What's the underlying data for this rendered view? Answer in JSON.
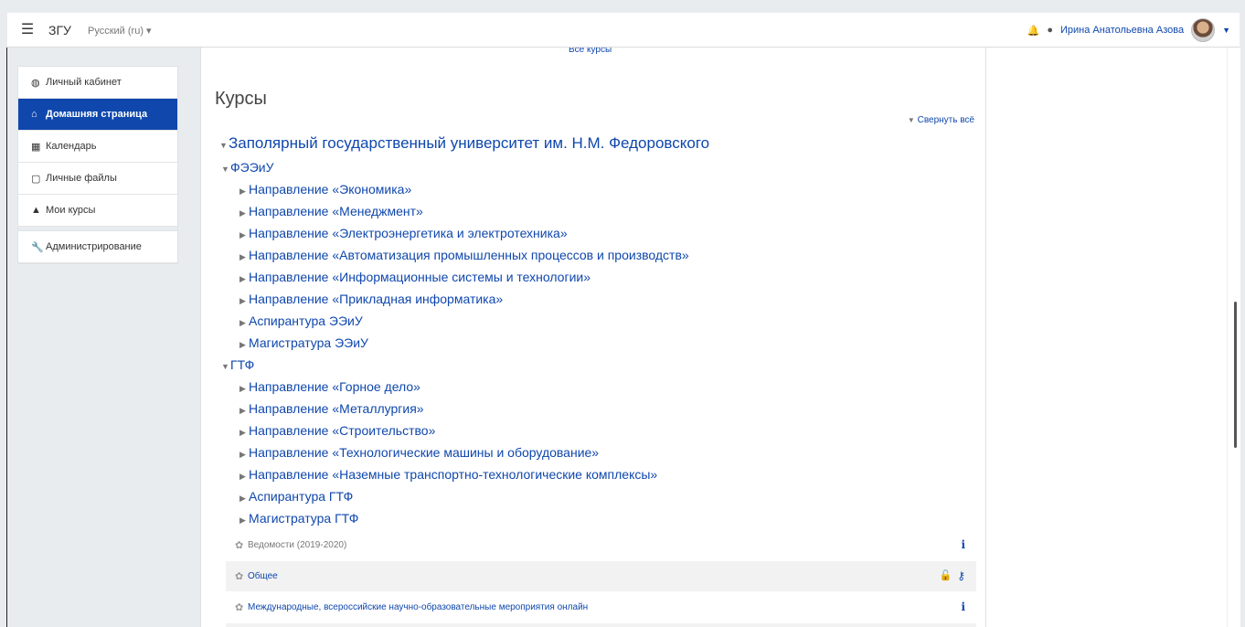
{
  "navbar": {
    "brand": "ЗГУ",
    "language": "Русский (ru) ▾",
    "username": "Ирина Анатольевна Азова",
    "icons": [
      "menu-icon",
      "bell-icon",
      "chat-icon",
      "user-caret-icon"
    ]
  },
  "sidebar": {
    "items": [
      {
        "label": "Личный кабинет",
        "icon": "dashboard-icon",
        "active": false
      },
      {
        "label": "Домашняя страница",
        "icon": "home-icon",
        "active": true
      },
      {
        "label": "Календарь",
        "icon": "calendar-icon",
        "active": false
      },
      {
        "label": "Личные файлы",
        "icon": "file-icon",
        "active": false
      },
      {
        "label": "Мои курсы",
        "icon": "graduation-cap-icon",
        "active": false
      }
    ],
    "admin": {
      "label": "Администрирование",
      "icon": "wrench-icon"
    }
  },
  "main": {
    "all_courses": "Все курсы",
    "title": "Курсы",
    "collapse_all": "Свернуть всё",
    "root_category": "Заполярный государственный университет им. Н.М. Федоровского",
    "groups": [
      {
        "name": "ФЭЭиУ",
        "items": [
          "Направление «Экономика»",
          "Направление «Менеджмент»",
          "Направление «Электроэнергетика и электротехника»",
          "Направление «Автоматизация промышленных процессов и производств»",
          "Направление «Информационные системы и технологии»",
          "Направление «Прикладная информатика»",
          "Аспирантура ЭЭиУ",
          "Магистратура ЭЭиУ"
        ]
      },
      {
        "name": "ГТФ",
        "items": [
          "Направление «Горное дело»",
          "Направление «Металлургия»",
          "Направление «Строительство»",
          "Направление «Технологические машины и оборудование»",
          "Направление «Наземные транспортно-технологические комплексы»",
          "Аспирантура ГТФ",
          "Магистратура ГТФ"
        ]
      }
    ],
    "courses": [
      {
        "name": "Ведомости (2019-2020)",
        "muted": true,
        "icons": [
          "info-icon"
        ]
      },
      {
        "name": "Общее",
        "muted": false,
        "icons": [
          "lock-icon",
          "key-icon"
        ]
      },
      {
        "name": "Международные, всероссийские научно-образовательные мероприятия онлайн",
        "muted": false,
        "icons": [
          "info-icon"
        ]
      }
    ]
  },
  "colors": {
    "accent": "#0f47ad",
    "background": "#e9ecef"
  }
}
